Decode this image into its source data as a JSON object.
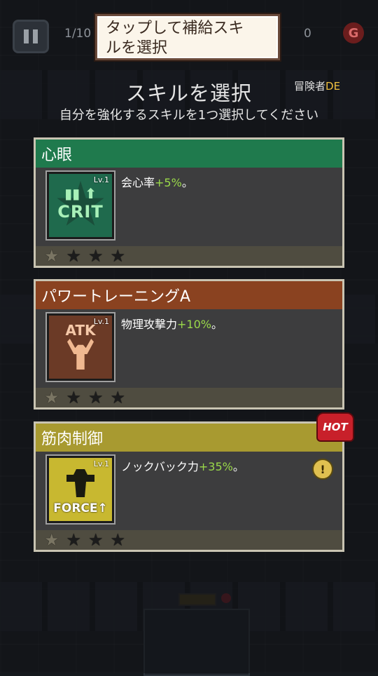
{
  "hud": {
    "wave": "1/10",
    "coins": "0",
    "currency_symbol": "G"
  },
  "tooltip": {
    "text_line1": "タップして補給スキ",
    "text_line2": "ルを選択"
  },
  "header": {
    "title": "スキルを選択",
    "adventurer_prefix": "冒険者",
    "adventurer_rank": "DE",
    "subtitle": "自分を強化するスキルを1つ選択してください"
  },
  "skills": [
    {
      "name": "心眼",
      "level": "Lv.1",
      "icon": "crit-icon",
      "icon_text": "CRIT",
      "desc_prefix": "会心率",
      "desc_value": "+5%",
      "desc_suffix": "。",
      "head_color": "#1f7a4d",
      "stars_filled": 1,
      "stars_total": 4
    },
    {
      "name": "パワートレーニングA",
      "level": "Lv.1",
      "icon": "atk-icon",
      "icon_text": "ATK",
      "desc_prefix": "物理攻撃力",
      "desc_value": "+10%",
      "desc_suffix": "。",
      "head_color": "#8a4220",
      "stars_filled": 1,
      "stars_total": 4
    },
    {
      "name": "筋肉制御",
      "level": "Lv.1",
      "icon": "force-icon",
      "icon_text": "FORCE↑",
      "desc_prefix": "ノックバック力",
      "desc_value": "+35%",
      "desc_suffix": "。",
      "head_color": "#a89a30",
      "stars_filled": 1,
      "stars_total": 4,
      "badge": "HOT"
    }
  ]
}
